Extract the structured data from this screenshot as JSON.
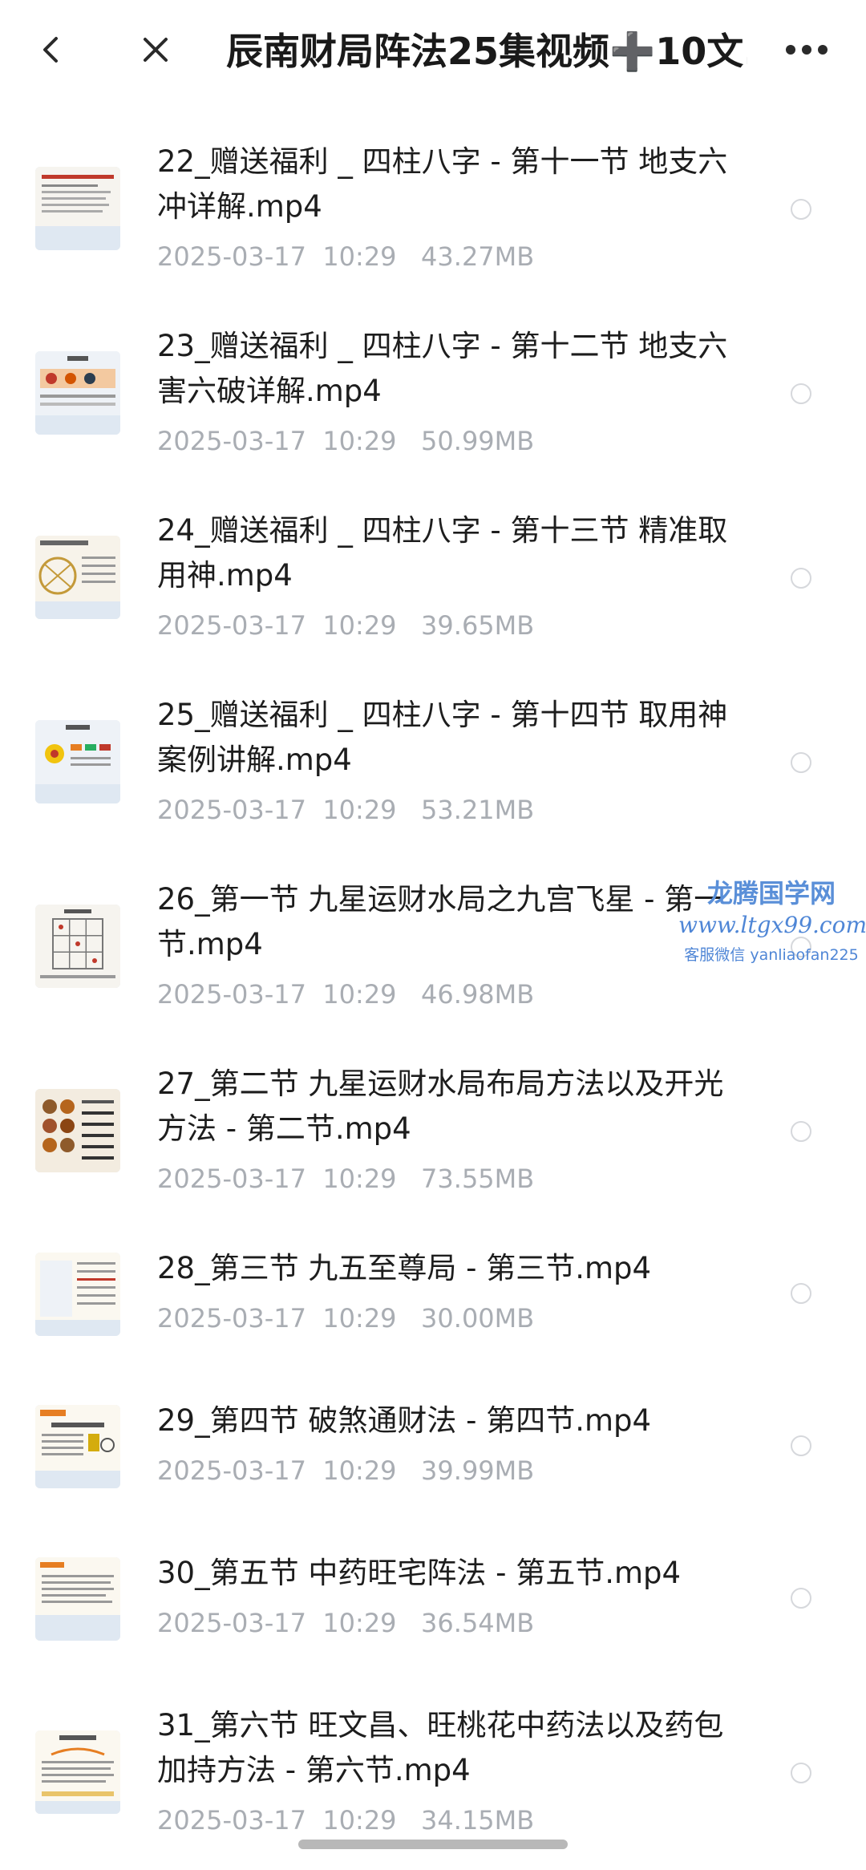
{
  "header": {
    "title": "辰南财局阵法25集视频➕10文...",
    "back_icon": "chevron-left-icon",
    "close_icon": "close-icon",
    "more_icon": "more-horizontal-icon"
  },
  "files": [
    {
      "name": "22_赠送福利 _ 四柱八字 - 第十一节 地支六冲详解.mp4",
      "date": "2025-03-17  10:29",
      "size": "43.27MB",
      "thumb": "document-thumbnail"
    },
    {
      "name": "23_赠送福利 _ 四柱八字 - 第十二节 地支六害六破详解.mp4",
      "date": "2025-03-17  10:29",
      "size": "50.99MB",
      "thumb": "chart-thumbnail"
    },
    {
      "name": "24_赠送福利 _ 四柱八字 - 第十三节 精准取用神.mp4",
      "date": "2025-03-17  10:29",
      "size": "39.65MB",
      "thumb": "diagram-thumbnail"
    },
    {
      "name": "25_赠送福利 _ 四柱八字 - 第十四节 取用神案例讲解.mp4",
      "date": "2025-03-17  10:29",
      "size": "53.21MB",
      "thumb": "case-thumbnail"
    },
    {
      "name": "26_第一节 九星运财水局之九宫飞星 - 第一节.mp4",
      "date": "2025-03-17  10:29",
      "size": "46.98MB",
      "thumb": "grid-thumbnail"
    },
    {
      "name": "27_第二节 九星运财水局布局方法以及开光方法 - 第二节.mp4",
      "date": "2025-03-17  10:29",
      "size": "73.55MB",
      "thumb": "zodiac-thumbnail"
    },
    {
      "name": "28_第三节 九五至尊局 - 第三节.mp4",
      "date": "2025-03-17  10:29",
      "size": "30.00MB",
      "thumb": "text-thumbnail"
    },
    {
      "name": "29_第四节 破煞通财法 - 第四节.mp4",
      "date": "2025-03-17  10:29",
      "size": "39.99MB",
      "thumb": "list-thumbnail"
    },
    {
      "name": "30_第五节 中药旺宅阵法 - 第五节.mp4",
      "date": "2025-03-17  10:29",
      "size": "36.54MB",
      "thumb": "text-thumbnail"
    },
    {
      "name": "31_第六节 旺文昌、旺桃花中药法以及药包加持方法 - 第六节.mp4",
      "date": "2025-03-17  10:29",
      "size": "34.15MB",
      "thumb": "text-thumbnail"
    }
  ],
  "watermark": {
    "line1": "龙腾国学网",
    "line2": "www.ltgx99.com",
    "line3": "客服微信 yanliaofan225"
  },
  "colors": {
    "text_primary": "#1d1d1d",
    "text_secondary": "#a9adb3",
    "watermark": "#4f86d6"
  }
}
